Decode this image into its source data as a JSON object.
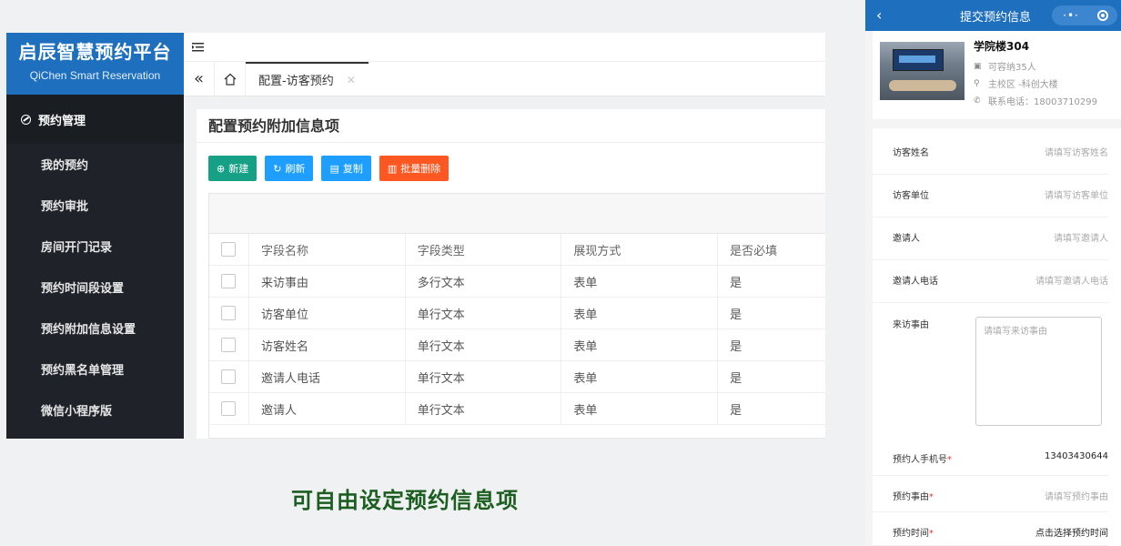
{
  "app": {
    "title": "启辰智慧预约平台",
    "subtitle": "QiChen Smart Reservation"
  },
  "sidebar": {
    "group": "预约管理",
    "items": [
      "我的预约",
      "预约审批",
      "房间开门记录",
      "预约时间段设置",
      "预约附加信息设置",
      "预约黑名单管理",
      "微信小程序版"
    ]
  },
  "tabs": [
    {
      "label": "配置-访客预约"
    }
  ],
  "panel": {
    "title": "配置预约附加信息项"
  },
  "toolbar": {
    "new": "新建",
    "refresh": "刷新",
    "copy": "复制",
    "batch_delete": "批量删除"
  },
  "table": {
    "headers": [
      "字段名称",
      "字段类型",
      "展现方式",
      "是否必填"
    ],
    "rows": [
      [
        "来访事由",
        "多行文本",
        "表单",
        "是"
      ],
      [
        "访客单位",
        "单行文本",
        "表单",
        "是"
      ],
      [
        "访客姓名",
        "单行文本",
        "表单",
        "是"
      ],
      [
        "邀请人电话",
        "单行文本",
        "表单",
        "是"
      ],
      [
        "邀请人",
        "单行文本",
        "表单",
        "是"
      ]
    ]
  },
  "caption": "可自由设定预约信息项",
  "mobile": {
    "title": "提交预约信息",
    "room": {
      "name": "学院楼304",
      "capacity": "可容纳35人",
      "location": "主校区 -科创大楼",
      "phone": "联系电话：18003710299"
    },
    "fields": [
      {
        "label": "访客姓名",
        "placeholder": "请填写访客姓名"
      },
      {
        "label": "访客单位",
        "placeholder": "请填写访客单位"
      },
      {
        "label": "邀请人",
        "placeholder": "请填写邀请人"
      },
      {
        "label": "邀请人电话",
        "placeholder": "请填写邀请人电话"
      }
    ],
    "reason": {
      "label": "来访事由",
      "placeholder": "请填写来访事由"
    },
    "phone_field": {
      "label": "预约人手机号",
      "value": "13403430644"
    },
    "purpose_field": {
      "label": "预约事由",
      "placeholder": "请填写预约事由"
    },
    "time_field": {
      "label": "预约时间",
      "value": "点击选择预约时间"
    },
    "required_mark": "*"
  },
  "colors": {
    "brand": "#1e6fbe",
    "new_btn": "#16a085",
    "info_btn": "#1e9fff",
    "danger_btn": "#ff5722",
    "caption": "#1b5e20"
  }
}
